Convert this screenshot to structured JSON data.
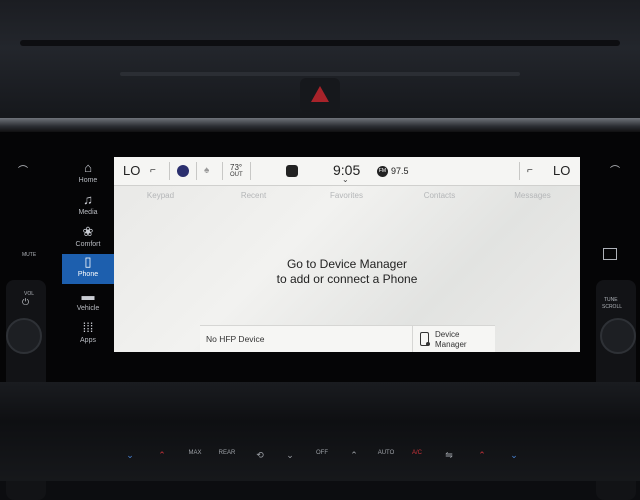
{
  "sidebar": {
    "items": [
      {
        "label": "Home",
        "icon": "home-icon"
      },
      {
        "label": "Media",
        "icon": "music-note-icon"
      },
      {
        "label": "Comfort",
        "icon": "comfort-icon"
      },
      {
        "label": "Phone",
        "icon": "phone-icon"
      },
      {
        "label": "Vehicle",
        "icon": "vehicle-icon"
      },
      {
        "label": "Apps",
        "icon": "apps-grid-icon"
      }
    ],
    "active": "Phone"
  },
  "statusbar": {
    "left_temp": "LO",
    "outside_temp": "73°",
    "outside_label": "OUT",
    "time": "9:05",
    "radio_band": "FM",
    "radio_freq": "97.5",
    "right_temp": "LO"
  },
  "tabs": [
    "Keypad",
    "Recent",
    "Favorites",
    "Contacts",
    "Messages"
  ],
  "message": {
    "line1": "Go to Device Manager",
    "line2": "to add or connect a Phone"
  },
  "bottom": {
    "status": "No HFP Device",
    "device_manager": "Device Manager"
  },
  "left_panel": {
    "mute": "MUTE",
    "vol": "VOL"
  },
  "right_panel": {
    "tune": "TUNE",
    "scroll": "SCROLL"
  },
  "console": {
    "max": "MAX",
    "rear": "REAR",
    "auto": "AUTO",
    "ac": "A/C",
    "off": "OFF"
  },
  "colors": {
    "accent": "#1d5fae",
    "hazard": "#a8232a"
  }
}
